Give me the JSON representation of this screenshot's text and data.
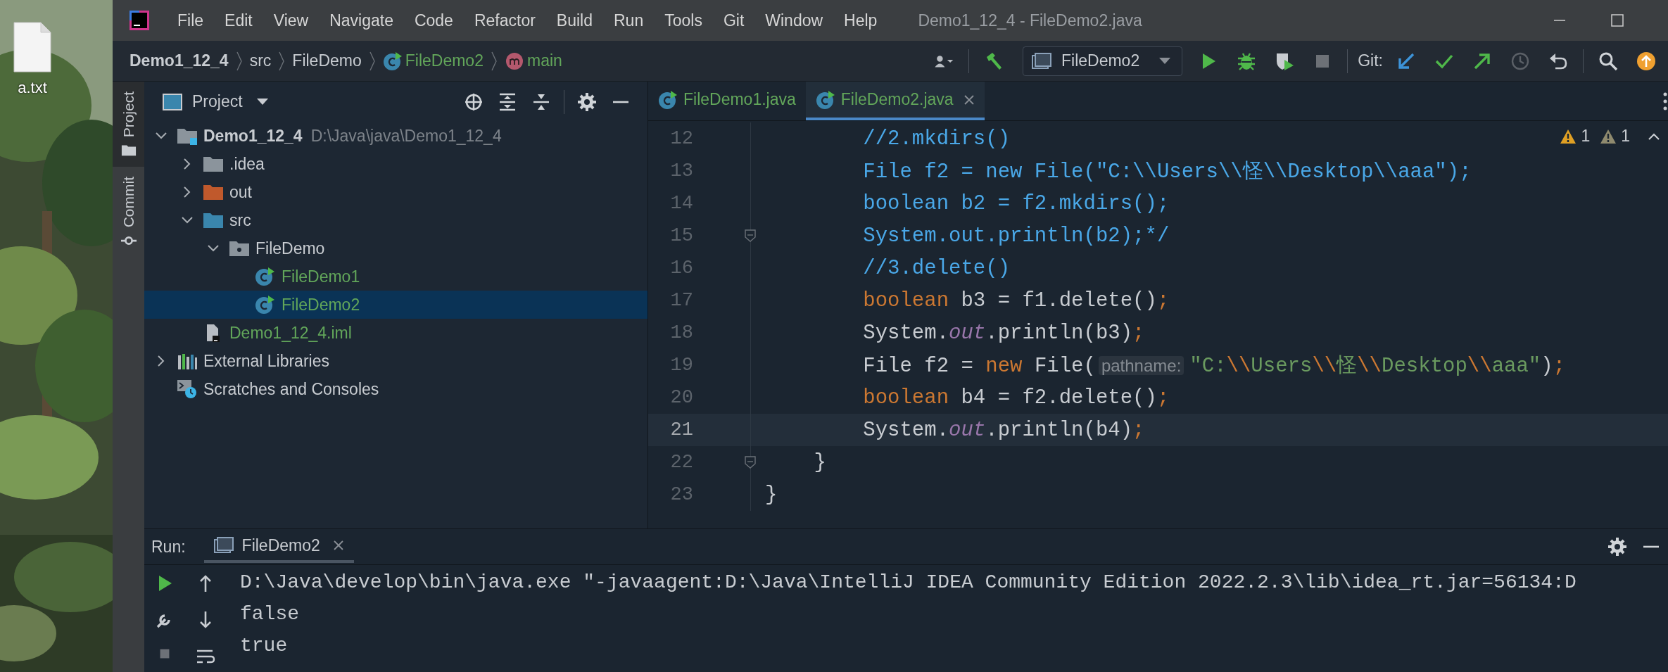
{
  "window": {
    "title": "Demo1_12_4 - FileDemo2.java"
  },
  "desktop": {
    "file_label": "a.txt"
  },
  "menu": [
    "File",
    "Edit",
    "View",
    "Navigate",
    "Code",
    "Refactor",
    "Build",
    "Run",
    "Tools",
    "Git",
    "Window",
    "Help"
  ],
  "breadcrumb": [
    {
      "label": "Demo1_12_4",
      "kind": "project"
    },
    {
      "label": "src",
      "kind": "folder"
    },
    {
      "label": "FileDemo",
      "kind": "folder"
    },
    {
      "label": "FileDemo2",
      "kind": "class"
    },
    {
      "label": "main",
      "kind": "method"
    }
  ],
  "toolbar": {
    "run_config": "FileDemo2",
    "git_label": "Git:"
  },
  "tool_strip": [
    {
      "label": "Project",
      "selected": true
    },
    {
      "label": "Commit",
      "selected": false
    }
  ],
  "project_panel": {
    "title": "Project",
    "tree": [
      {
        "label": "Demo1_12_4",
        "path": "D:\\Java\\java\\Demo1_12_4",
        "kind": "project",
        "expanded": true,
        "selected": false,
        "children": [
          {
            "label": ".idea",
            "kind": "folder",
            "expanded": false,
            "selected": false
          },
          {
            "label": "out",
            "kind": "excluded",
            "expanded": false,
            "selected": false
          },
          {
            "label": "src",
            "kind": "source",
            "expanded": true,
            "selected": false,
            "children": [
              {
                "label": "FileDemo",
                "kind": "package",
                "expanded": true,
                "selected": false,
                "children": [
                  {
                    "label": "FileDemo1",
                    "kind": "class",
                    "selected": false
                  },
                  {
                    "label": "FileDemo2",
                    "kind": "class",
                    "selected": true
                  }
                ]
              }
            ]
          },
          {
            "label": "Demo1_12_4.iml",
            "kind": "iml",
            "selected": false
          }
        ]
      },
      {
        "label": "External Libraries",
        "kind": "libraries",
        "expanded": false,
        "selected": false
      },
      {
        "label": "Scratches and Consoles",
        "kind": "scratches",
        "selected": false
      }
    ]
  },
  "editor": {
    "tabs": [
      {
        "label": "FileDemo1.java",
        "selected": false
      },
      {
        "label": "FileDemo2.java",
        "selected": true
      }
    ],
    "inspections": [
      {
        "kind": "warning",
        "count": "1"
      },
      {
        "kind": "weak",
        "count": "1"
      }
    ],
    "lines": [
      {
        "number": "12",
        "fold": false,
        "current": false,
        "tokens": [
          {
            "t": "        //2.mkdirs()",
            "kind": "comment"
          }
        ]
      },
      {
        "number": "13",
        "fold": false,
        "current": false,
        "tokens": [
          {
            "t": "        File f2 = new File(\"C:\\\\Users\\\\怪\\\\Desktop\\\\aaa\");",
            "kind": "comment"
          }
        ]
      },
      {
        "number": "14",
        "fold": false,
        "current": false,
        "tokens": [
          {
            "t": "        boolean b2 = f2.mkdirs();",
            "kind": "comment"
          }
        ]
      },
      {
        "number": "15",
        "fold": true,
        "current": false,
        "tokens": [
          {
            "t": "        System.out.println(b2);*/",
            "kind": "comment"
          }
        ]
      },
      {
        "number": "16",
        "fold": false,
        "current": false,
        "tokens": [
          {
            "t": "        //3.delete()",
            "kind": "comment"
          }
        ]
      },
      {
        "number": "17",
        "fold": false,
        "current": false,
        "tokens": [
          {
            "t": "        boolean",
            "kind": "keyword"
          },
          {
            "t": " b3 = f1.delete()",
            "kind": "plain"
          },
          {
            "t": ";",
            "kind": "keyword"
          }
        ]
      },
      {
        "number": "18",
        "fold": false,
        "current": false,
        "tokens": [
          {
            "t": "        System.",
            "kind": "plain"
          },
          {
            "t": "out",
            "kind": "field"
          },
          {
            "t": ".println(b3)",
            "kind": "plain"
          },
          {
            "t": ";",
            "kind": "keyword"
          }
        ]
      },
      {
        "number": "19",
        "fold": false,
        "current": false,
        "tokens": [
          {
            "t": "        File f2 = ",
            "kind": "plain"
          },
          {
            "t": "new",
            "kind": "keyword"
          },
          {
            "t": " File(",
            "kind": "plain"
          },
          {
            "t": "pathname:",
            "kind": "hint"
          },
          {
            "t": "\"C:",
            "kind": "string"
          },
          {
            "t": "\\\\",
            "kind": "escape"
          },
          {
            "t": "Users",
            "kind": "string"
          },
          {
            "t": "\\\\",
            "kind": "escape"
          },
          {
            "t": "怪",
            "kind": "string"
          },
          {
            "t": "\\\\",
            "kind": "escape"
          },
          {
            "t": "Desktop",
            "kind": "string"
          },
          {
            "t": "\\\\",
            "kind": "escape"
          },
          {
            "t": "aaa\"",
            "kind": "string"
          },
          {
            "t": ")",
            "kind": "plain"
          },
          {
            "t": ";",
            "kind": "keyword"
          }
        ]
      },
      {
        "number": "20",
        "fold": false,
        "current": false,
        "tokens": [
          {
            "t": "        boolean",
            "kind": "keyword"
          },
          {
            "t": " b4 = f2.delete()",
            "kind": "plain"
          },
          {
            "t": ";",
            "kind": "keyword"
          }
        ]
      },
      {
        "number": "21",
        "fold": false,
        "current": true,
        "tokens": [
          {
            "t": "        System.",
            "kind": "plain"
          },
          {
            "t": "out",
            "kind": "field"
          },
          {
            "t": ".println(b4)",
            "kind": "plain"
          },
          {
            "t": ";",
            "kind": "keyword"
          }
        ]
      },
      {
        "number": "22",
        "fold": true,
        "current": false,
        "tokens": [
          {
            "t": "    }",
            "kind": "plain"
          }
        ]
      },
      {
        "number": "23",
        "fold": false,
        "current": false,
        "tokens": [
          {
            "t": "}",
            "kind": "plain"
          }
        ]
      }
    ]
  },
  "run_panel": {
    "label": "Run:",
    "tab": "FileDemo2",
    "output": [
      "D:\\Java\\develop\\bin\\java.exe \"-javaagent:D:\\Java\\IntelliJ IDEA Community Edition 2022.2.3\\lib\\idea_rt.jar=56134:D",
      "false",
      "true"
    ]
  }
}
